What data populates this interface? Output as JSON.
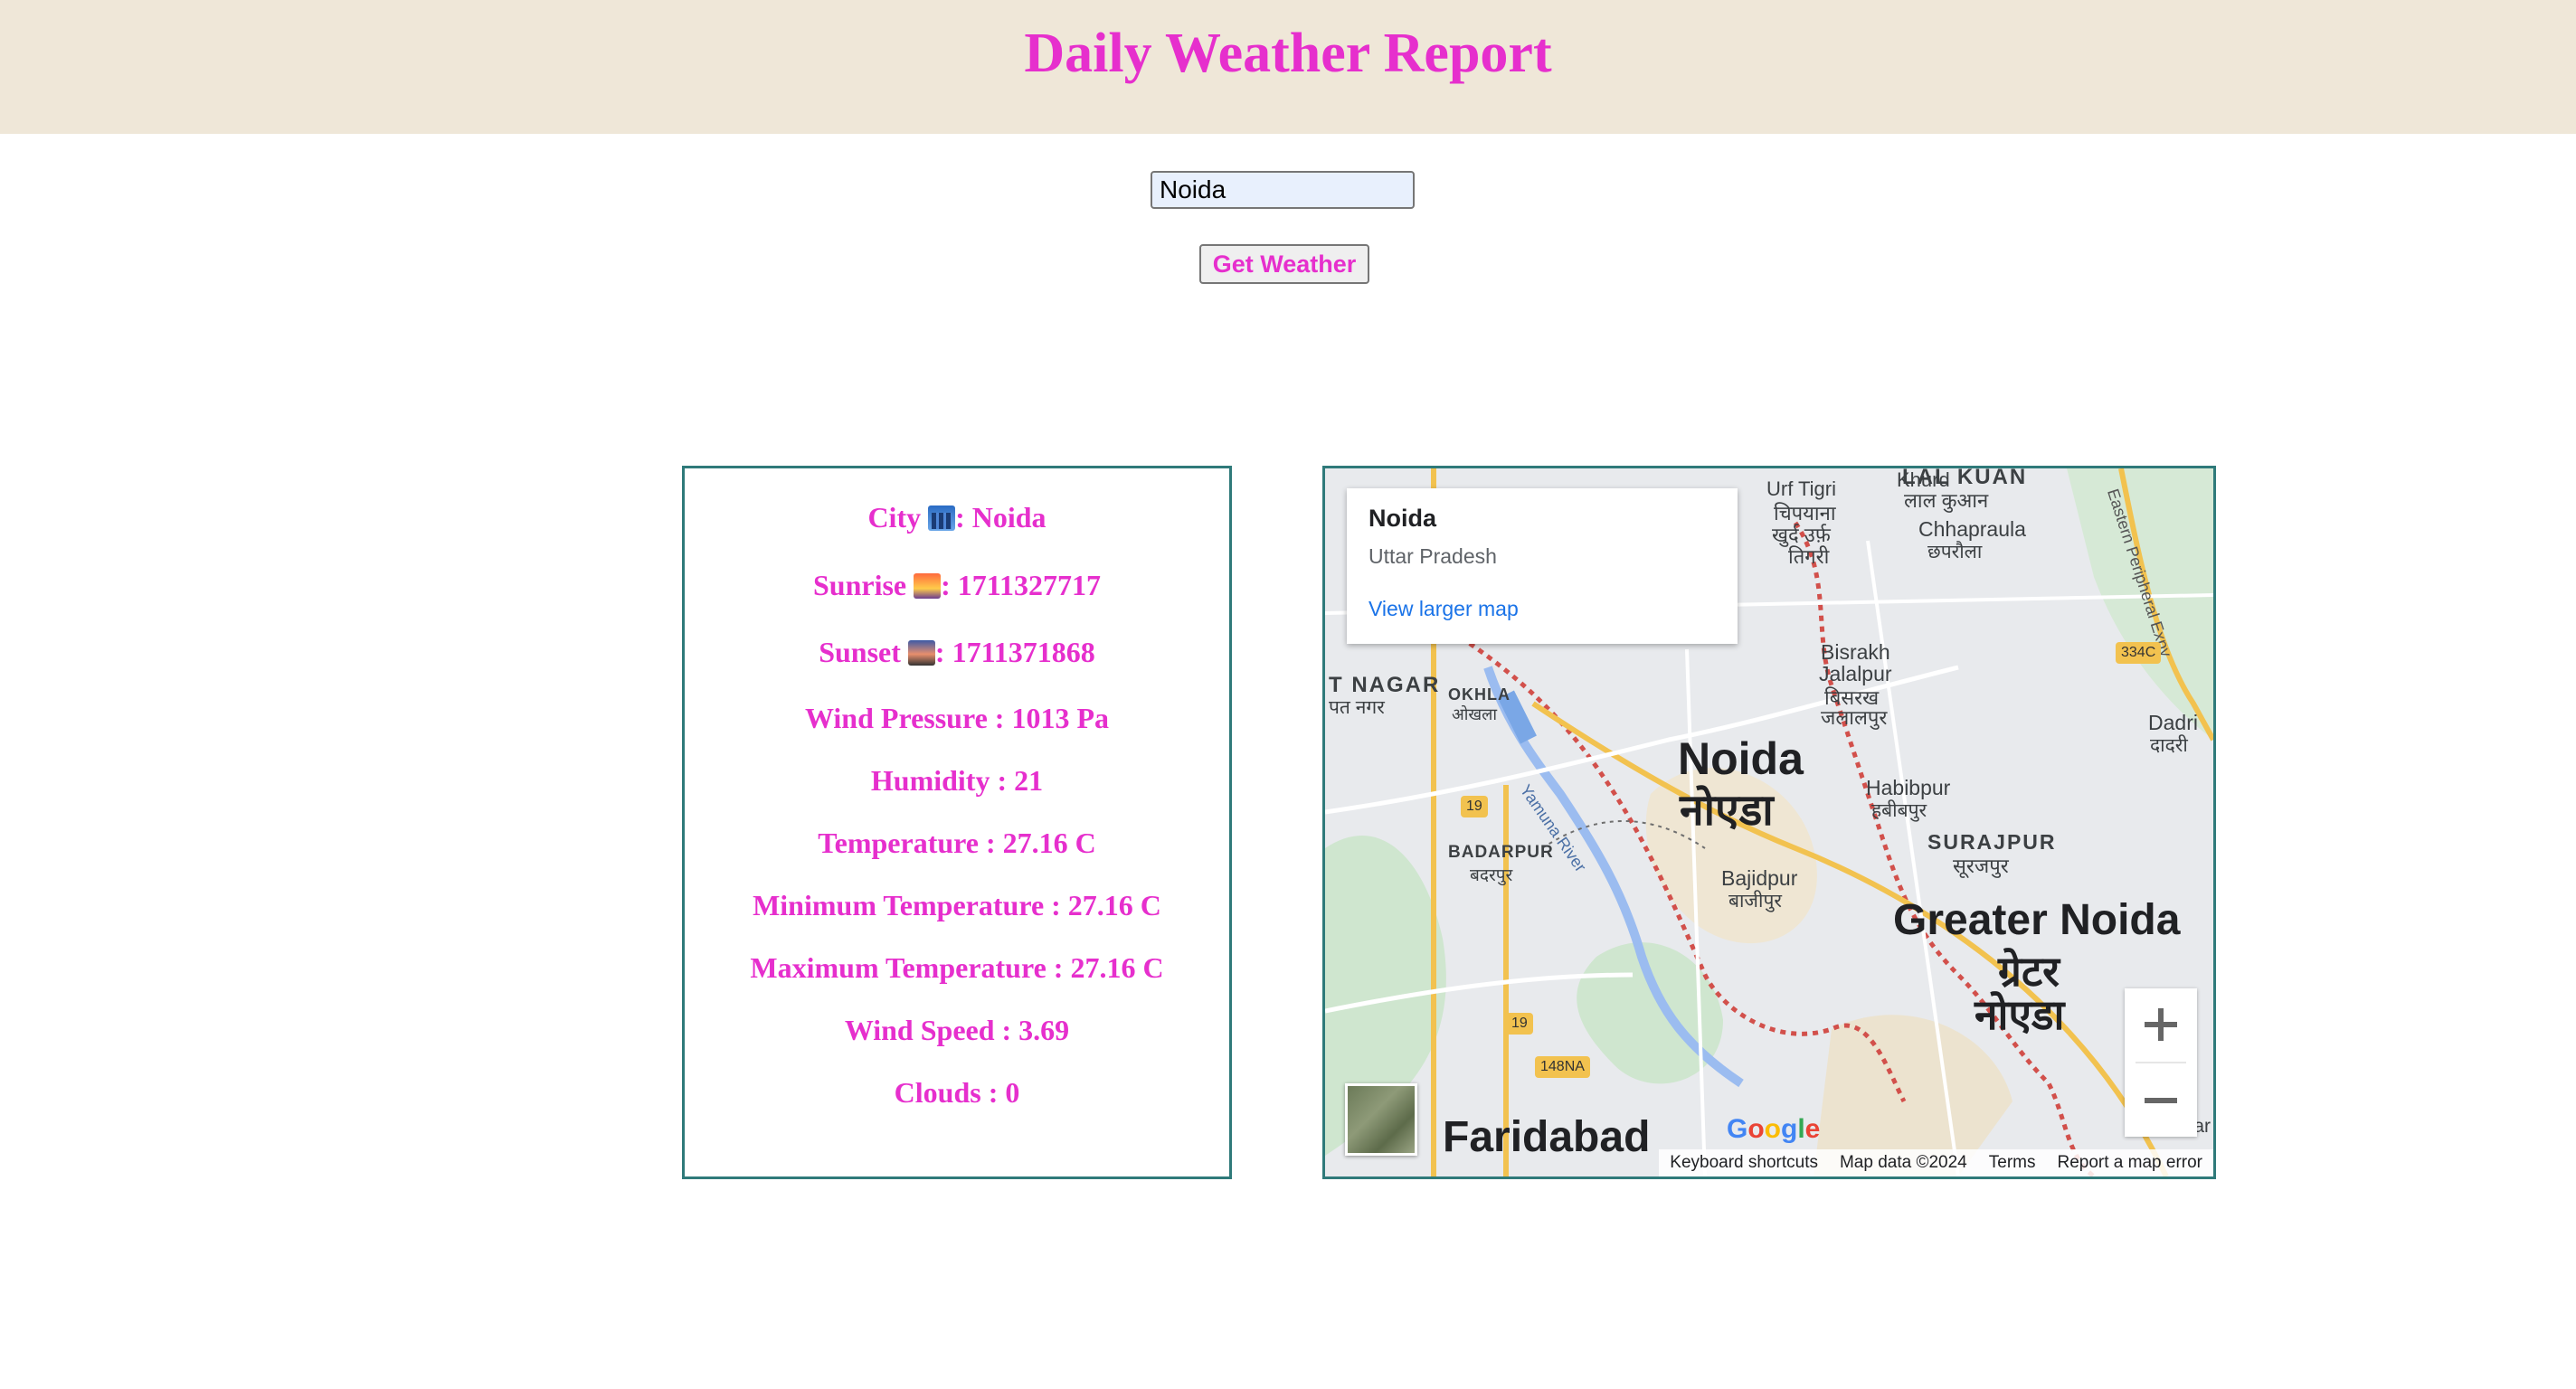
{
  "header": {
    "title": "Daily Weather Report"
  },
  "search": {
    "value": "Noida",
    "button_label": "Get Weather"
  },
  "weather": {
    "city_label": "City",
    "city_value": ": Noida",
    "sunrise_label": "Sunrise",
    "sunrise_value": ": 1711327717",
    "sunset_label": "Sunset",
    "sunset_value": ": 1711371868",
    "pressure": "Wind Pressure : 1013 Pa",
    "humidity": "Humidity : 21",
    "temperature": "Temperature : 27.16 C",
    "min_temperature": "Minimum Temperature : 27.16 C",
    "max_temperature": "Maximum Temperature : 27.16 C",
    "wind_speed": "Wind Speed : 3.69",
    "clouds": "Clouds : 0"
  },
  "map": {
    "popup": {
      "place": "Noida",
      "region": "Uttar Pradesh",
      "link": "View larger map"
    },
    "labels": {
      "noida_en": "Noida",
      "noida_hi": "नोएडा",
      "greater_noida_en": "Greater Noida",
      "greater_noida_hi_1": "ग्रेटर",
      "greater_noida_hi_2": "नोएडा",
      "faridabad": "Faridabad",
      "lal_kuan_en": "LAL KUAN",
      "lal_kuan_hi": "लाल कुआन",
      "chhapraula_en": "Chhapraula",
      "chhapraula_hi": "छपरौला",
      "khurd_1": "Khurd",
      "khurd_2": "Urf Tigri",
      "khurd_3": "चिपयाना",
      "khurd_4": "खुर्द उर्फ़",
      "khurd_5": "तिगरी",
      "bisrakh_1": "Bisrakh",
      "bisrakh_2": "Jalalpur",
      "bisrakh_3": "बिसरख",
      "bisrakh_4": "जलालपुर",
      "habibpur_en": "Habibpur",
      "habibpur_hi": "हबीबपुर",
      "surajpur_en": "SURAJPUR",
      "surajpur_hi": "सूरजपुर",
      "bajidpur_en": "Bajidpur",
      "bajidpur_hi": "बाजीपुर",
      "badarpur_en": "BADARPUR",
      "badarpur_hi": "बदरपुर",
      "okhla_en": "OKHLA",
      "okhla_hi": "ओखला",
      "t_nagar_en": "T NAGAR",
      "t_nagar_hi": "पत नगर",
      "dadri_en": "Dadri",
      "dadri_hi": "दादरी",
      "yamuna": "Yamuna River",
      "expressway": "Eastern Peripheral Expy",
      "luksar": "Luksar",
      "road_334c": "334C",
      "road_19a": "19",
      "road_19b": "19",
      "road_148na": "148NA"
    },
    "attribution": {
      "shortcuts": "Keyboard shortcuts",
      "map_data": "Map data ©2024",
      "terms": "Terms",
      "report": "Report a map error"
    },
    "logo": "Google"
  }
}
